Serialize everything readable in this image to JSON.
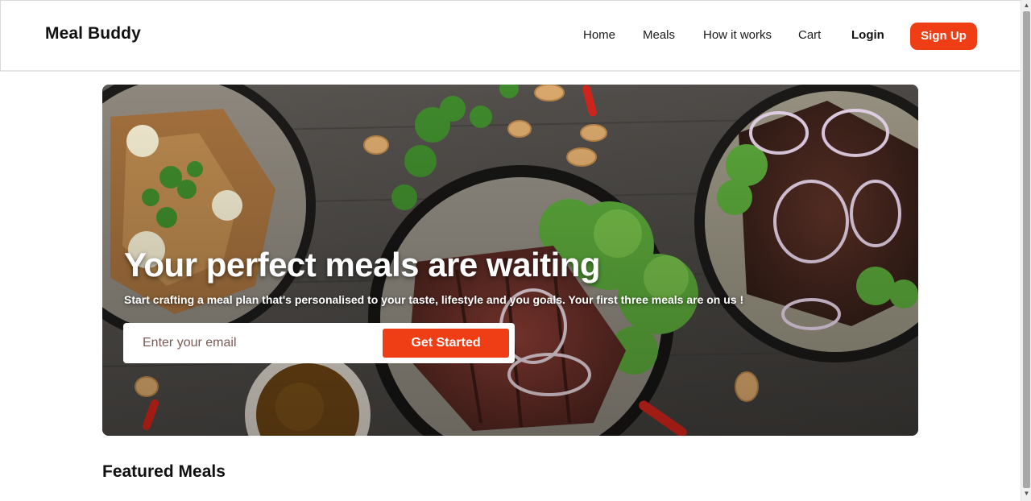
{
  "header": {
    "logo": "Meal Buddy",
    "nav": {
      "home": "Home",
      "meals": "Meals",
      "how_it_works": "How it works",
      "cart": "Cart",
      "login": "Login"
    },
    "signup": "Sign Up"
  },
  "hero": {
    "title": "Your perfect meals are waiting",
    "subtitle": "Start crafting a meal plan that's personalised to your taste, lifestyle and you goals. Your first three meals are on us !",
    "email_placeholder": "Enter your email",
    "cta": "Get Started"
  },
  "featured": {
    "title": "Featured Meals"
  },
  "colors": {
    "accent": "#ef3d15",
    "hero_background": "#4a4845"
  }
}
